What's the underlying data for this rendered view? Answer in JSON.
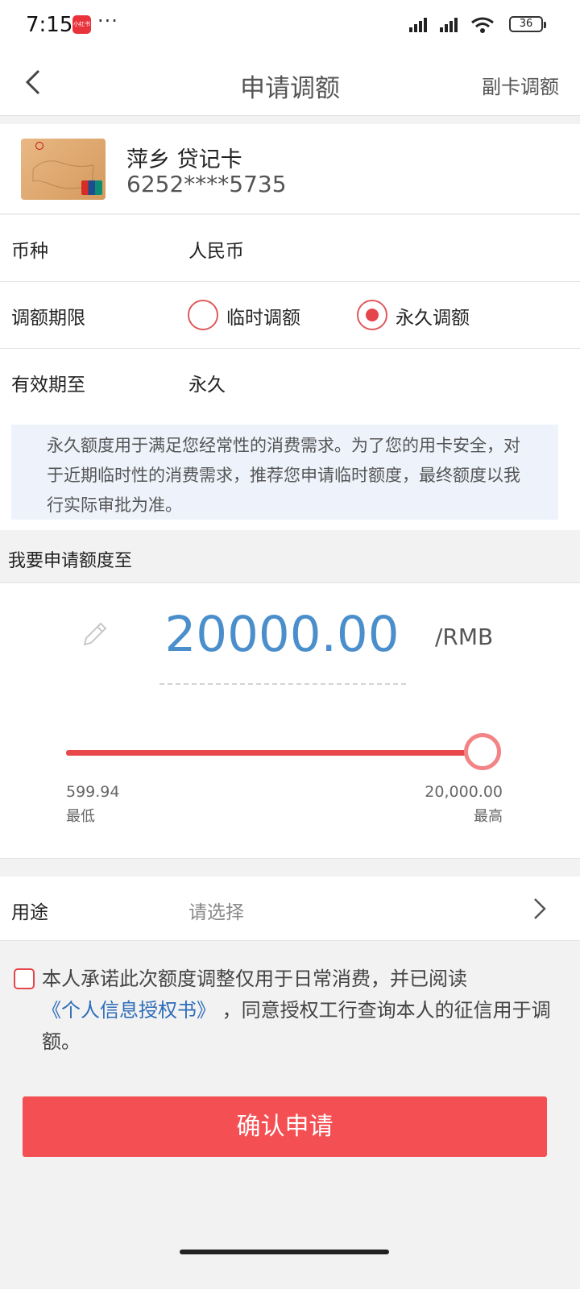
{
  "status_bar": {
    "time": "7:15",
    "app_badge": "小红书",
    "more": "···",
    "battery": "36"
  },
  "nav": {
    "title": "申请调额",
    "right_action": "副卡调额"
  },
  "card": {
    "name": "萍乡  贷记卡",
    "number": "6252****5735"
  },
  "currency": {
    "label": "币种",
    "value": "人民币"
  },
  "term": {
    "label": "调额期限",
    "options": [
      {
        "label": "临时调额",
        "selected": false
      },
      {
        "label": "永久调额",
        "selected": true
      }
    ]
  },
  "valid_until": {
    "label": "有效期至",
    "value": "永久"
  },
  "info_text": "永久额度用于满足您经常性的消费需求。为了您的用卡安全，对于近期临时性的消费需求，推荐您申请临时额度，最终额度以我行实际审批为准。",
  "apply_section": {
    "heading": "我要申请额度至",
    "amount": "20000.00",
    "unit": "/RMB",
    "slider": {
      "min_value": "599.94",
      "min_label": "最低",
      "max_value": "20,000.00",
      "max_label": "最高",
      "level_fraction": 1.0
    }
  },
  "purpose": {
    "label": "用途",
    "placeholder": "请选择"
  },
  "agreement": {
    "checked": false,
    "text_before": "本人承诺此次额度调整仅用于日常消费，并已阅读",
    "link": "《个人信息授权书》",
    "text_after": "，同意授权工行查询本人的征信用于调额。"
  },
  "confirm_button": "确认申请",
  "colors": {
    "accent_red": "#f44f52",
    "amount_blue": "#4a8fcb",
    "link_blue": "#2e6db8"
  }
}
